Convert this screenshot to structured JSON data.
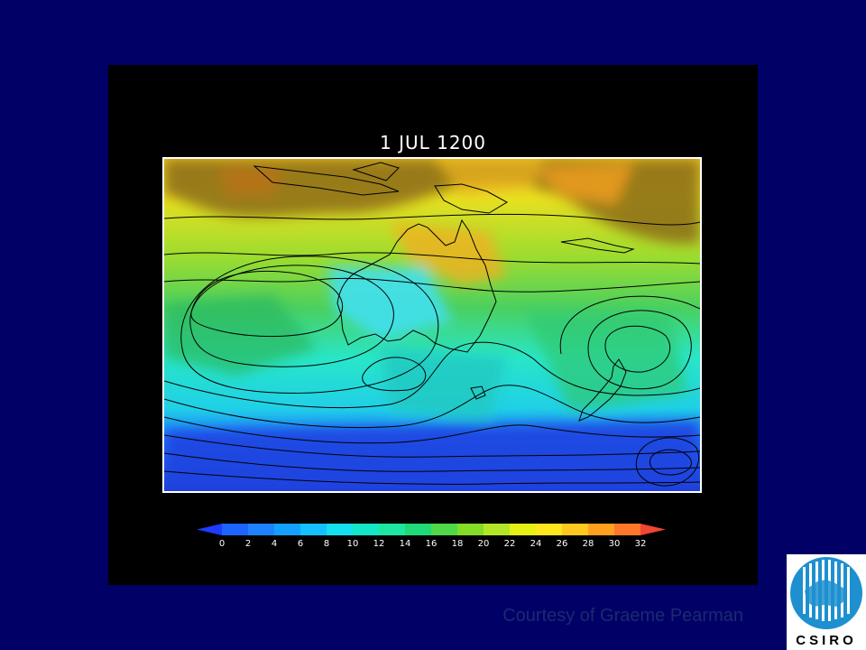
{
  "map": {
    "title": "1 JUL 1200",
    "colorbar": {
      "ticks": [
        "0",
        "2",
        "4",
        "6",
        "8",
        "10",
        "12",
        "14",
        "16",
        "18",
        "20",
        "22",
        "24",
        "26",
        "28",
        "30",
        "32"
      ],
      "colors": [
        "#1e64ff",
        "#1e82ff",
        "#14a0ff",
        "#14c0ff",
        "#14e0f0",
        "#14e6c8",
        "#1ee6a0",
        "#20d878",
        "#50d848",
        "#82dc28",
        "#b4e628",
        "#e6f014",
        "#ffe61e",
        "#ffc81e",
        "#ffa01e",
        "#ff782a"
      ],
      "under_color": "#1e3cff",
      "over_color": "#f04632"
    }
  },
  "credit": "Courtesy of Graeme Pearman",
  "logo": {
    "text": "CSIRO"
  }
}
